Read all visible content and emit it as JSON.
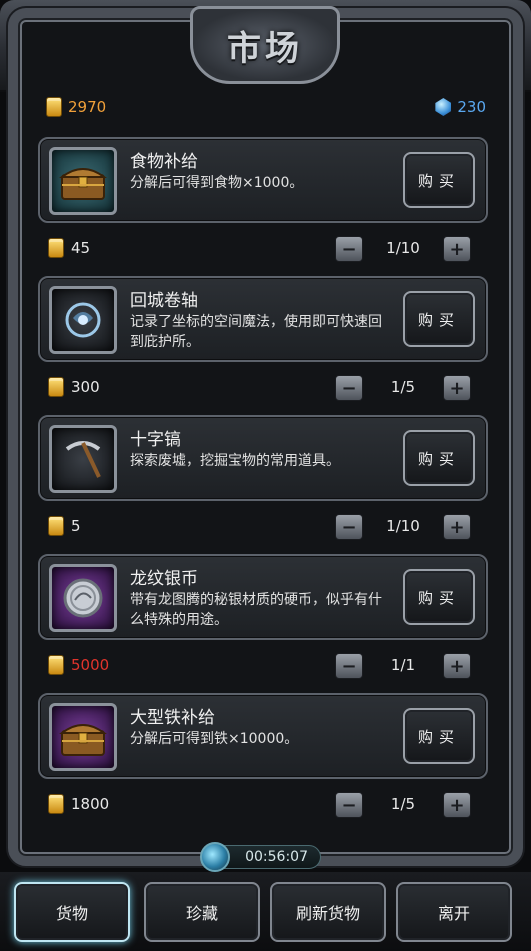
{
  "header": {
    "title": "市场"
  },
  "currency": {
    "gold": "2970",
    "gems": "230"
  },
  "items": [
    {
      "name": "食物补给",
      "desc": "分解后可得到食物×1000。",
      "price": "45",
      "qty": "1/10",
      "buy_label": "购买",
      "icon": "treasure-chest-icon",
      "price_color": "#e8e8e8"
    },
    {
      "name": "回城卷轴",
      "desc": "记录了坐标的空间魔法，使用即可快速回到庇护所。",
      "price": "300",
      "qty": "1/5",
      "buy_label": "购买",
      "icon": "magic-scroll-icon",
      "price_color": "#e8e8e8"
    },
    {
      "name": "十字镐",
      "desc": "探索废墟，挖掘宝物的常用道具。",
      "price": "5",
      "qty": "1/10",
      "buy_label": "购买",
      "icon": "pickaxe-icon",
      "price_color": "#e8e8e8"
    },
    {
      "name": "龙纹银币",
      "desc": "带有龙图腾的秘银材质的硬币，似乎有什么特殊的用途。",
      "price": "5000",
      "qty": "1/1",
      "buy_label": "购买",
      "icon": "silver-coin-icon",
      "price_color": "#e0342c"
    },
    {
      "name": "大型铁补给",
      "desc": "分解后可得到铁×10000。",
      "price": "1800",
      "qty": "1/5",
      "buy_label": "购买",
      "icon": "treasure-chest-icon",
      "price_color": "#e8e8e8"
    }
  ],
  "timer": "00:56:07",
  "tabs": [
    "货物",
    "珍藏",
    "刷新货物",
    "离开"
  ]
}
